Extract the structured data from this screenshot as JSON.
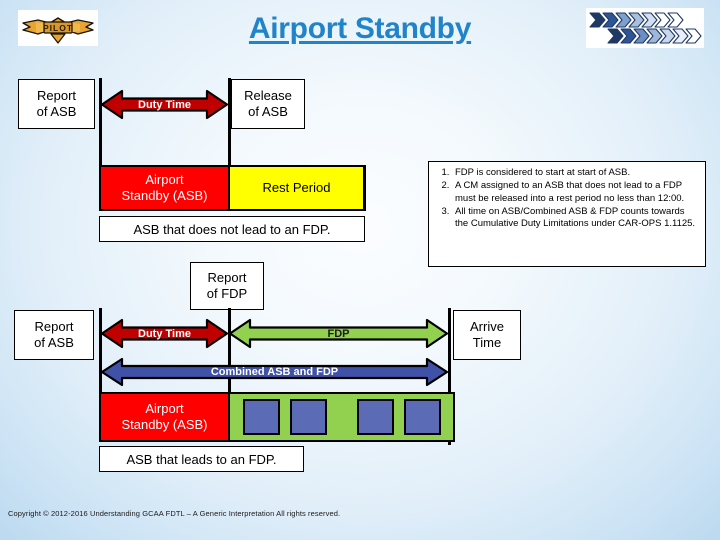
{
  "header": {
    "title": "Airport Standby",
    "left_logo_alt": "PILOT wings badge",
    "right_logo_alt": "chevron arrows banner"
  },
  "diagram_top": {
    "name": "ASB that does not lead to an FDP",
    "report_box": "Report\nof ASB",
    "report_box_line1": "Report",
    "report_box_line2": "of ASB",
    "release_box_line1": "Release",
    "release_box_line2": "of ASB",
    "duty_arrow_label": "Duty Time",
    "asb_block_line1": "Airport",
    "asb_block_line2": "Standby (ASB)",
    "rest_block_label": "Rest Period",
    "caption": "ASB that does not lead to an FDP."
  },
  "diagram_bottom": {
    "name": "ASB that leads to an FDP",
    "report_fdp_line1": "Report",
    "report_fdp_line2": "of FDP",
    "report_asb_line1": "Report",
    "report_asb_line2": "of ASB",
    "arrive_line1": "Arrive",
    "arrive_line2": "Time",
    "duty_arrow_label": "Duty Time",
    "fdp_arrow_label": "FDP",
    "combined_arrow_label": "Combined ASB and FDP",
    "asb_block_line1": "Airport",
    "asb_block_line2": "Standby (ASB)",
    "caption": "ASB that leads to an FDP.",
    "sector_count": 4
  },
  "notes": [
    "FDP is considered to start at start of ASB.",
    "A CM assigned to an ASB that does not lead to a FDP must be released into a rest period no less than 12:00.",
    "All time on ASB/Combined ASB & FDP counts towards the Cumulative Duty Limitations under CAR-OPS 1.1125."
  ],
  "footer": {
    "copyright": "Copyright © 2012-2016 Understanding GCAA FDTL – A Generic Interpretation All rights reserved."
  },
  "colors": {
    "title": "#2183c9",
    "duty_arrow": "#c00000",
    "fdp_arrow": "#92d050",
    "combined_arrow": "#4051a8",
    "asb_block": "#ff0000",
    "rest_block": "#ffff00",
    "fdp_block": "#92d050",
    "sector": "#5b6bb5"
  }
}
